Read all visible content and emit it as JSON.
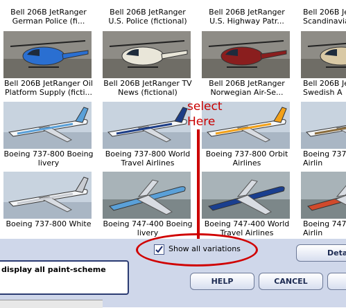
{
  "gallery": {
    "top_captions": [
      [
        "Bell 206B JetRanger",
        "German Police (fi..."
      ],
      [
        "Bell 206B JetRanger",
        "U.S. Police (fictional)"
      ],
      [
        "Bell 206B JetRanger",
        "U.S. Highway Patr..."
      ],
      [
        "Bell 206B JetRanger",
        "Scandinavia"
      ]
    ],
    "items": [
      {
        "name": "helicopter",
        "color": "#2a6fd1",
        "caption": [
          "Bell 206B JetRanger Oil",
          "Platform Supply (ficti..."
        ]
      },
      {
        "name": "helicopter",
        "color": "#e9e6d9",
        "caption": [
          "Bell 206B JetRanger TV",
          "News (fictional)"
        ]
      },
      {
        "name": "helicopter",
        "color": "#8a1e1e",
        "caption": [
          "Bell 206B JetRanger",
          "Norwegian Air-Se..."
        ]
      },
      {
        "name": "helicopter",
        "color": "#d9c9a5",
        "caption": [
          "Bell 206B JetRan",
          "Swedish A"
        ]
      },
      {
        "name": "airliner",
        "color": "#5aa0d8",
        "caption": [
          "Boeing 737-800 Boeing",
          "livery"
        ]
      },
      {
        "name": "airliner",
        "color": "#1c3d87",
        "caption": [
          "Boeing 737-800 World",
          "Travel Airlines"
        ]
      },
      {
        "name": "airliner",
        "color": "#f2a11a",
        "caption": [
          "Boeing 737-800 Orbit",
          "Airlines"
        ]
      },
      {
        "name": "airliner",
        "color": "#8a6c3c",
        "caption": [
          "Boeing 737-8",
          "Airlin"
        ]
      },
      {
        "name": "airliner",
        "color": "#c9ccd2",
        "caption": [
          "Boeing 737-800 White",
          ""
        ]
      },
      {
        "name": "jumbo",
        "color": "#5aa0d8",
        "caption": [
          "Boeing 747-400 Boeing",
          "livery"
        ]
      },
      {
        "name": "jumbo",
        "color": "#1a3f8f",
        "caption": [
          "Boeing 747-400 World",
          "Travel Airlines"
        ]
      },
      {
        "name": "jumbo",
        "color": "#d14a2b",
        "caption": [
          "Boeing 747-400",
          "Airlin"
        ]
      }
    ]
  },
  "annotation": "select\nHere",
  "show_all": {
    "label": "Show all variations",
    "checked": true
  },
  "description": "display all paint-scheme",
  "buttons": {
    "details": "Detai",
    "help": "HELP",
    "cancel": "CANCEL"
  }
}
